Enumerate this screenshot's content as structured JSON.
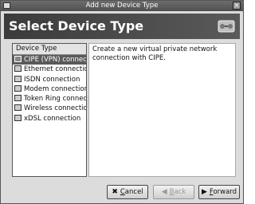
{
  "window": {
    "title": "Add new Device Type",
    "close_glyph": "×"
  },
  "header": {
    "title": "Select Device Type"
  },
  "device_list": {
    "column_header": "Device Type",
    "items": [
      {
        "label": "CIPE (VPN) connecti",
        "icon": "vpn-icon",
        "selected": true
      },
      {
        "label": "Ethernet connection",
        "icon": "ethernet-icon",
        "selected": false
      },
      {
        "label": "ISDN connection",
        "icon": "isdn-icon",
        "selected": false
      },
      {
        "label": "Modem connection",
        "icon": "modem-icon",
        "selected": false
      },
      {
        "label": "Token Ring connectic",
        "icon": "token-ring-icon",
        "selected": false
      },
      {
        "label": "Wireless connection",
        "icon": "wireless-icon",
        "selected": false
      },
      {
        "label": "xDSL connection",
        "icon": "xdsl-icon",
        "selected": false
      }
    ]
  },
  "description": {
    "text": "Create a new virtual private network connection with CIPE."
  },
  "buttons": {
    "cancel": {
      "label": "Cancel",
      "underline": "C",
      "icon": "x-icon"
    },
    "back": {
      "label": "Back",
      "underline": "B",
      "icon": "left-arrow-icon",
      "disabled": true
    },
    "forward": {
      "label": "Forward",
      "underline": "F",
      "icon": "right-arrow-icon"
    }
  }
}
